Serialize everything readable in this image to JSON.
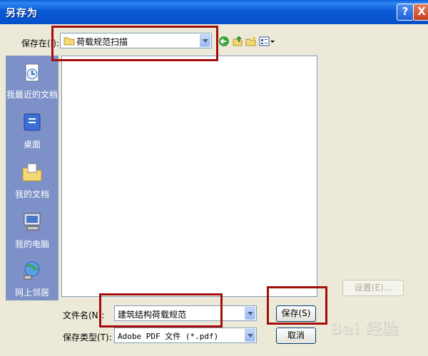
{
  "window": {
    "title": "另存为",
    "help_label": "?",
    "close_label": "X"
  },
  "save_in": {
    "label": "保存在(I):",
    "value": "荷载规范扫描"
  },
  "places": [
    {
      "label": "我最近的文档",
      "icon": "recent-docs-icon"
    },
    {
      "label": "桌面",
      "icon": "desktop-icon"
    },
    {
      "label": "我的文档",
      "icon": "my-documents-icon"
    },
    {
      "label": "我的电脑",
      "icon": "my-computer-icon"
    },
    {
      "label": "网上邻居",
      "icon": "network-icon"
    }
  ],
  "filename": {
    "label": "文件名(N):",
    "value": "建筑结构荷载规范"
  },
  "filetype": {
    "label": "保存类型(T):",
    "value": "Adobe PDF 文件 (*.pdf)"
  },
  "buttons": {
    "settings": "设置(E)...",
    "save": "保存(S)",
    "cancel": "取消"
  },
  "watermark": "Bai 经验",
  "colors": {
    "titlebar": "#0b5ad6",
    "dialog_bg": "#ece9d8",
    "highlight": "#a50d0d",
    "places_bg": "#7d91c8"
  }
}
